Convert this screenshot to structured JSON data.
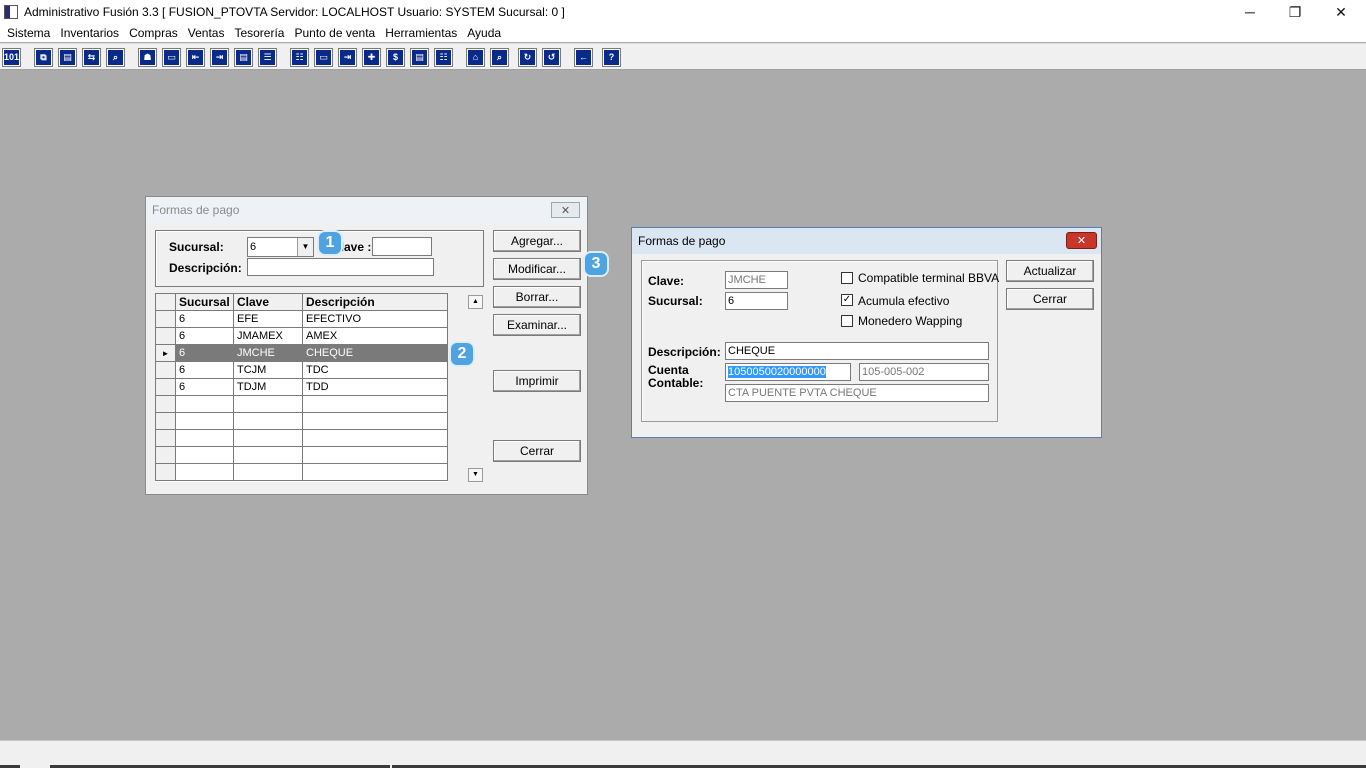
{
  "window": {
    "title": "Administrativo Fusión 3.3 [ FUSION_PTOVTA   Servidor: LOCALHOST   Usuario: SYSTEM    Sucursal: 0 ]",
    "minimize": "─",
    "restore": "❐",
    "close": "✕"
  },
  "menu": [
    "Sistema",
    "Inventarios",
    "Compras",
    "Ventas",
    "Tesorería",
    "Punto de venta",
    "Herramientas",
    "Ayuda"
  ],
  "toolbar_glyphs": [
    "101",
    "⧉",
    "▤",
    "⇆",
    "⌕",
    "☗",
    "▭",
    "⇤",
    "⇥",
    "▤",
    "☰",
    "☷",
    "▭",
    "⇥",
    "✚",
    "$",
    "▤",
    "☷",
    "⌂",
    "⌕",
    "↻",
    "↺",
    "←",
    "?"
  ],
  "left_dialog": {
    "caption": "Formas de pago",
    "close_glyph": "✕",
    "sucursal_label": "Sucursal:",
    "sucursal_value": "6",
    "clave_label": "Clave :",
    "clave_value": "",
    "descripcion_label": "Descripción:",
    "descripcion_value": "",
    "buttons": {
      "agregar": "Agregar...",
      "modificar": "Modificar...",
      "borrar": "Borrar...",
      "examinar": "Examinar...",
      "imprimir": "Imprimir",
      "cerrar": "Cerrar"
    },
    "grid": {
      "columns": [
        "Sucursal",
        "Clave",
        "Descripción"
      ],
      "rows": [
        {
          "sucursal": "6",
          "clave": "EFE",
          "descripcion": "EFECTIVO"
        },
        {
          "sucursal": "6",
          "clave": "JMAMEX",
          "descripcion": "AMEX"
        },
        {
          "sucursal": "6",
          "clave": "JMCHE",
          "descripcion": "CHEQUE"
        },
        {
          "sucursal": "6",
          "clave": "TCJM",
          "descripcion": "TDC"
        },
        {
          "sucursal": "6",
          "clave": "TDJM",
          "descripcion": "TDD"
        }
      ],
      "selected_row_marker": "►"
    }
  },
  "badges": [
    "1",
    "2",
    "3"
  ],
  "right_dialog": {
    "caption": "Formas de pago",
    "close_glyph": "✕",
    "clave_label": "Clave:",
    "clave_value": "JMCHE",
    "sucursal_label": "Sucursal:",
    "sucursal_value": "6",
    "check1_label": "Compatible terminal BBVA",
    "check1_checked": false,
    "check2_label": "Acumula efectivo",
    "check2_checked": true,
    "check3_label": "Monedero Wapping",
    "check3_checked": false,
    "check_mark": "✓",
    "descripcion_label": "Descripción:",
    "descripcion_value": "CHEQUE",
    "cuenta_label_1": "Cuenta",
    "cuenta_label_2": "Contable:",
    "cuenta_value": "1050050020000000",
    "cuenta_formatted": "105-005-002",
    "cuenta_nombre": "CTA PUENTE PVTA CHEQUE",
    "buttons": {
      "actualizar": "Actualizar",
      "cerrar": "Cerrar"
    }
  },
  "colors": {
    "desktop": "#ababab",
    "badge": "#4fa3e0",
    "selection": "#3399ff",
    "close_red": "#c8352a"
  }
}
